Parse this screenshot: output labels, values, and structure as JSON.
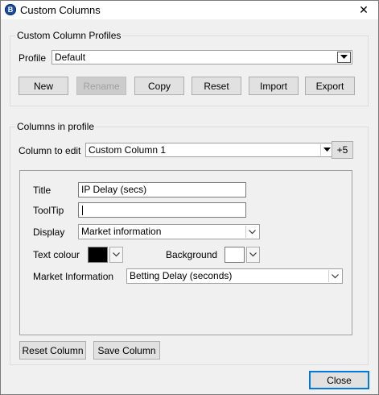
{
  "window": {
    "title": "Custom Columns",
    "app_icon_letter": "B",
    "close_glyph": "✕"
  },
  "profiles_group": {
    "legend": "Custom Column Profiles",
    "profile_label": "Profile",
    "profile_value": "Default",
    "buttons": {
      "new": "New",
      "rename": "Rename",
      "copy": "Copy",
      "reset": "Reset",
      "import": "Import",
      "export": "Export"
    }
  },
  "columns_group": {
    "legend": "Columns in profile",
    "column_label": "Column to edit",
    "column_value": "Custom Column 1",
    "plus_button": "+5",
    "fields": {
      "title_label": "Title",
      "title_value": "IP Delay (secs)",
      "tooltip_label": "ToolTip",
      "tooltip_value": "",
      "display_label": "Display",
      "display_value": "Market information",
      "text_colour_label": "Text colour",
      "text_colour": "#000000",
      "background_label": "Background",
      "background_colour": "#ffffff",
      "market_info_label": "Market Information",
      "market_info_value": "Betting Delay (seconds)"
    },
    "reset_column": "Reset Column",
    "save_column": "Save Column"
  },
  "footer": {
    "close": "Close"
  }
}
